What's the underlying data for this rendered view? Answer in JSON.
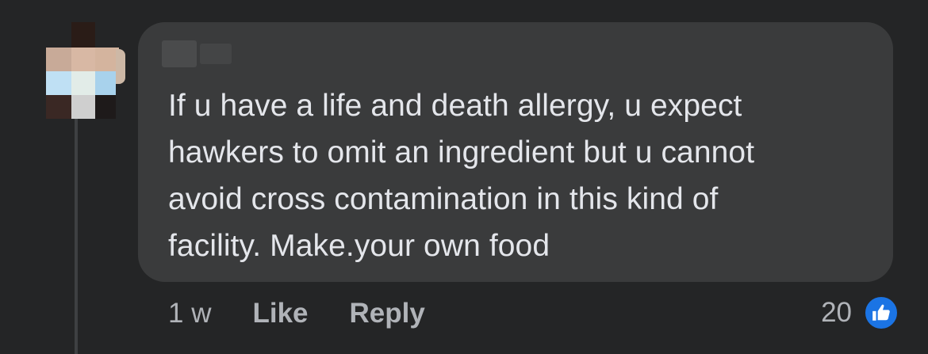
{
  "comment": {
    "text_lines": [
      "If u have a life and death allergy, u expect",
      "hawkers to omit an ingredient but u cannot",
      "avoid cross contamination in this kind of",
      "facility. Make.your own food"
    ]
  },
  "actions": {
    "timestamp": "1 w",
    "like_label": "Like",
    "reply_label": "Reply"
  },
  "reactions": {
    "count": "20",
    "icon": "thumbs-up-icon"
  },
  "colors": {
    "background": "#242526",
    "bubble": "#3a3b3c",
    "text": "#e4e6eb",
    "secondary_text": "#b0b3b8",
    "like_blue": "#1b74e4"
  }
}
